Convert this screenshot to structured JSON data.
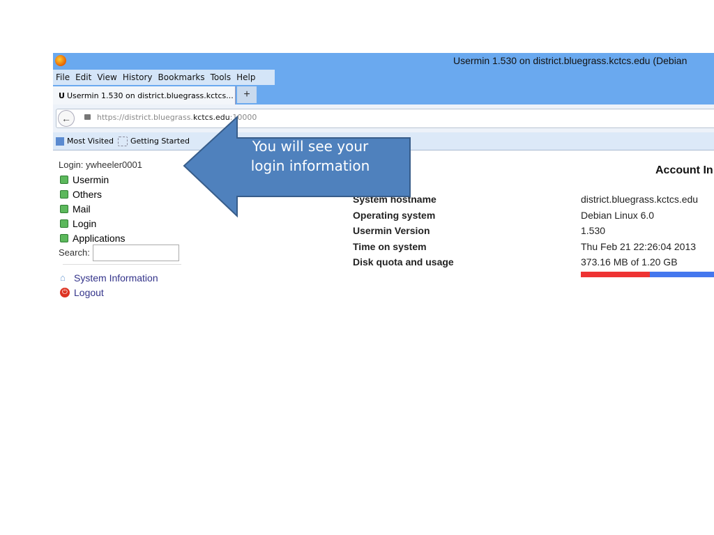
{
  "window": {
    "title": "Usermin 1.530 on district.bluegrass.kctcs.edu (Debian"
  },
  "menu": [
    "File",
    "Edit",
    "View",
    "History",
    "Bookmarks",
    "Tools",
    "Help"
  ],
  "tab": {
    "label": "Usermin 1.530 on district.bluegrass.kctcs...",
    "new_tab": "+"
  },
  "url": {
    "prefix": "https://district.bluegrass.",
    "domain": "kctcs.edu",
    "suffix": ":10000"
  },
  "bookmarks": [
    "Most Visited",
    "Getting Started"
  ],
  "sidebar": {
    "login": "Login: ywheeler0001",
    "categories": [
      "Usermin",
      "Others",
      "Mail",
      "Login",
      "Applications"
    ],
    "search_label": "Search:",
    "search_value": "",
    "links": [
      "System Information",
      "Logout"
    ]
  },
  "main": {
    "title": "Account In",
    "rows": [
      {
        "label": "System hostname",
        "value": "district.bluegrass.kctcs.edu"
      },
      {
        "label": "Operating system",
        "value": "Debian Linux 6.0"
      },
      {
        "label": "Usermin Version",
        "value": "1.530"
      },
      {
        "label": "Time on system",
        "value": "Thu Feb 21 22:26:04 2013"
      },
      {
        "label": "Disk quota and usage",
        "value": "373.16 MB of 1.20 GB"
      }
    ],
    "disk_used_fraction": 0.31
  },
  "callout": {
    "text": "You will see your login information",
    "color": "#4f81bd"
  }
}
